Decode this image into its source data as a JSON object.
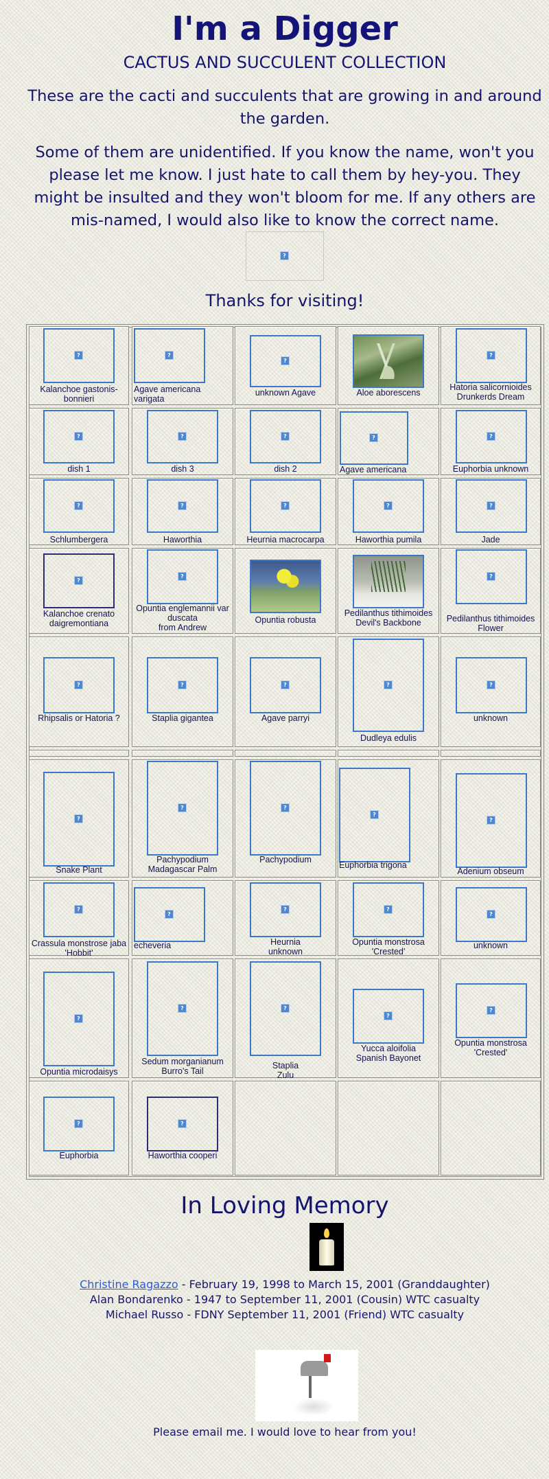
{
  "header": {
    "title": "I'm a Digger",
    "subtitle": "CACTUS AND SUCCULENT COLLECTION",
    "intro1": "These are the cacti and succulents that are growing in and around the garden.",
    "intro2": "Some of them are unidentified.  If you know the name, won't you please let me know.  I just hate to call them by hey-you. They might be insulted and they won't bloom for me.  If any others are mis-named,  I would also like to know the correct name.",
    "thanks": "Thanks for visiting!"
  },
  "captions": {
    "c0_0": "Kalanchoe gastonis-\nbonnieri",
    "c0_1": "Agave americana\nvarigata",
    "c0_2": "unknown Agave",
    "c0_3": "Aloe aborescens",
    "c0_4": "Hatoria salicornioides\nDrunkerds Dream",
    "c1_0": "dish 1",
    "c1_1": "dish 3",
    "c1_2": "dish 2",
    "c1_3": "Agave americana",
    "c1_4": "Euphorbia unknown",
    "c2_0": "Schlumbergera",
    "c2_1": "Haworthia",
    "c2_2": "Heurnia macrocarpa",
    "c2_3": "Haworthia pumila",
    "c2_4": "Jade",
    "c3_0": "Kalanchoe crenato\ndaigremontiana",
    "c3_1": "Opuntia englemannii var\nduscata\nfrom Andrew",
    "c3_2": "Opuntia robusta",
    "c3_3": "Pedilanthus tithimoides\nDevil's Backbone",
    "c3_4": "Pedilanthus tithimoides\nFlower",
    "c4_0": "Rhipsalis or Hatoria ?",
    "c4_1": "Staplia gigantea",
    "c4_2": "Agave parryi",
    "c4_3": "Dudleya edulis",
    "c4_4": "unknown",
    "c5_0": "Snake Plant",
    "c5_1": "Pachypodium\nMadagascar Palm",
    "c5_2": "Pachypodium",
    "c5_3": "Euphorbia trigona",
    "c5_4": "Adenium obseum",
    "c6_0": "Crassula monstrose jaba\n'Hobbit'",
    "c6_1": "echeveria",
    "c6_2": "Heurnia\nunknown",
    "c6_3": "Opuntia monstrosa\n'Crested'",
    "c6_4": "unknown",
    "c7_0": "Opuntia microdaisys",
    "c7_1": "Sedum morganianum\nBurro's Tail",
    "c7_2": "Staplia\nZulu",
    "c7_3": "Yucca aloifolia\nSpanish Bayonet",
    "c7_4": "Opuntia monstrosa\n'Crested'",
    "c8_0": "Euphorbia",
    "c8_1": "Haworthia cooperi"
  },
  "memory": {
    "heading": "In Loving Memory",
    "person1_name": "Christine Ragazzo",
    "person1_rest": " - February 19, 1998 to March 15, 2001  (Granddaughter)",
    "line2": "Alan Bondarenko  - 1947 to September 11, 2001 (Cousin) WTC casualty",
    "line3": "Michael Russo - FDNY September 11, 2001 (Friend) WTC casualty"
  },
  "footer": {
    "email_text": "Please email me.  I would love to hear from you!"
  },
  "icons": {
    "broken_image": "?"
  }
}
